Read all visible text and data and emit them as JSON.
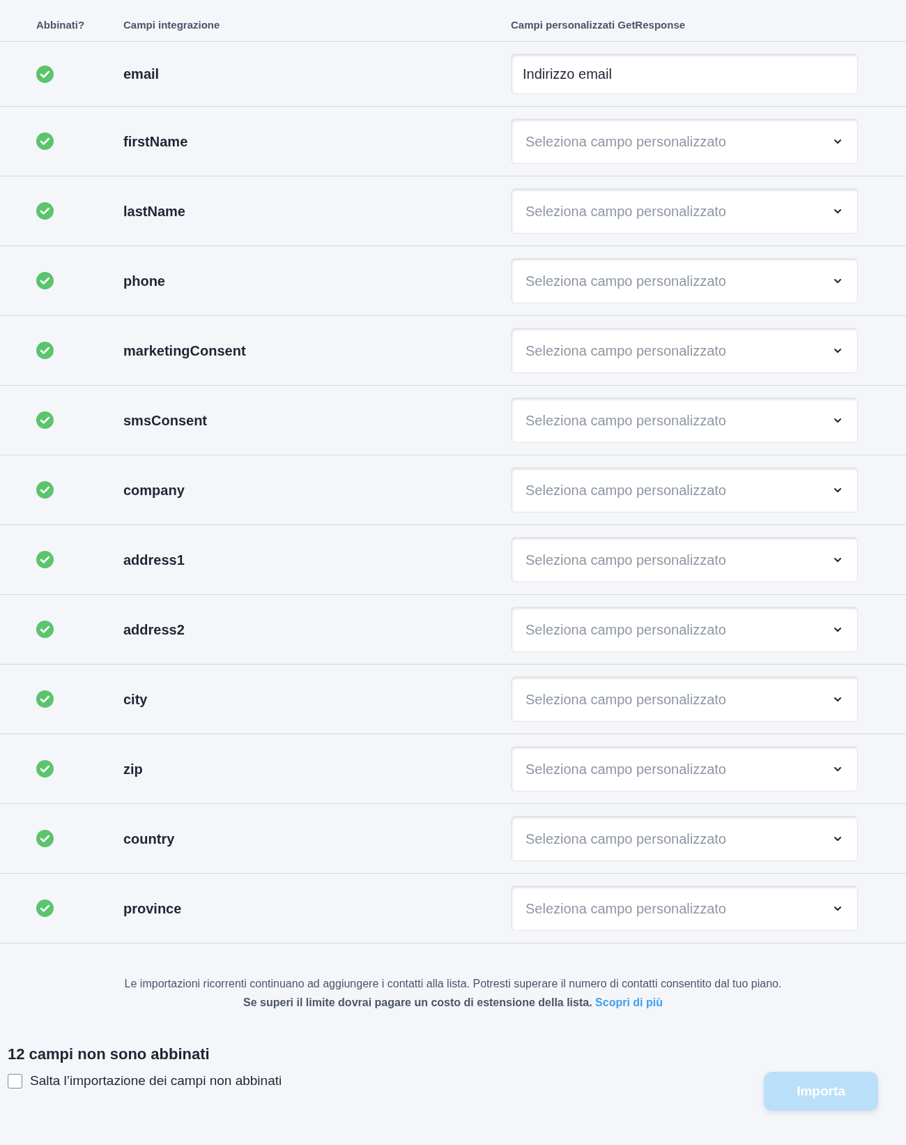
{
  "table": {
    "columns": [
      "Abbinati?",
      "Campi integrazione",
      "Campi personalizzati GetResponse"
    ],
    "rows": [
      {
        "matched": true,
        "field": "email",
        "target": {
          "kind": "text",
          "value": "Indirizzo email"
        }
      },
      {
        "matched": true,
        "field": "firstName",
        "target": {
          "kind": "select",
          "placeholder": "Seleziona campo personalizzato"
        }
      },
      {
        "matched": true,
        "field": "lastName",
        "target": {
          "kind": "select",
          "placeholder": "Seleziona campo personalizzato"
        }
      },
      {
        "matched": true,
        "field": "phone",
        "target": {
          "kind": "select",
          "placeholder": "Seleziona campo personalizzato"
        }
      },
      {
        "matched": true,
        "field": "marketingConsent",
        "target": {
          "kind": "select",
          "placeholder": "Seleziona campo personalizzato"
        }
      },
      {
        "matched": true,
        "field": "smsConsent",
        "target": {
          "kind": "select",
          "placeholder": "Seleziona campo personalizzato"
        }
      },
      {
        "matched": true,
        "field": "company",
        "target": {
          "kind": "select",
          "placeholder": "Seleziona campo personalizzato"
        }
      },
      {
        "matched": true,
        "field": "address1",
        "target": {
          "kind": "select",
          "placeholder": "Seleziona campo personalizzato"
        }
      },
      {
        "matched": true,
        "field": "address2",
        "target": {
          "kind": "select",
          "placeholder": "Seleziona campo personalizzato"
        }
      },
      {
        "matched": true,
        "field": "city",
        "target": {
          "kind": "select",
          "placeholder": "Seleziona campo personalizzato"
        }
      },
      {
        "matched": true,
        "field": "zip",
        "target": {
          "kind": "select",
          "placeholder": "Seleziona campo personalizzato"
        }
      },
      {
        "matched": true,
        "field": "country",
        "target": {
          "kind": "select",
          "placeholder": "Seleziona campo personalizzato"
        }
      },
      {
        "matched": true,
        "field": "province",
        "target": {
          "kind": "select",
          "placeholder": "Seleziona campo personalizzato"
        }
      }
    ]
  },
  "notice": {
    "text": "Le importazioni ricorrenti continuano ad aggiungere i contatti alla lista. Potresti superare il numero di contatti consentito dal tuo piano.",
    "warning": "Se superi il limite dovrai pagare un costo di estensione della lista.",
    "link": "Scopri di più"
  },
  "unmatched": {
    "heading": "12 campi non sono abbinati",
    "skip_checkbox": {
      "label": "Salta l’importazione dei campi non abbinati",
      "checked": false
    }
  },
  "import_button": {
    "label": "Importa",
    "disabled": true
  }
}
